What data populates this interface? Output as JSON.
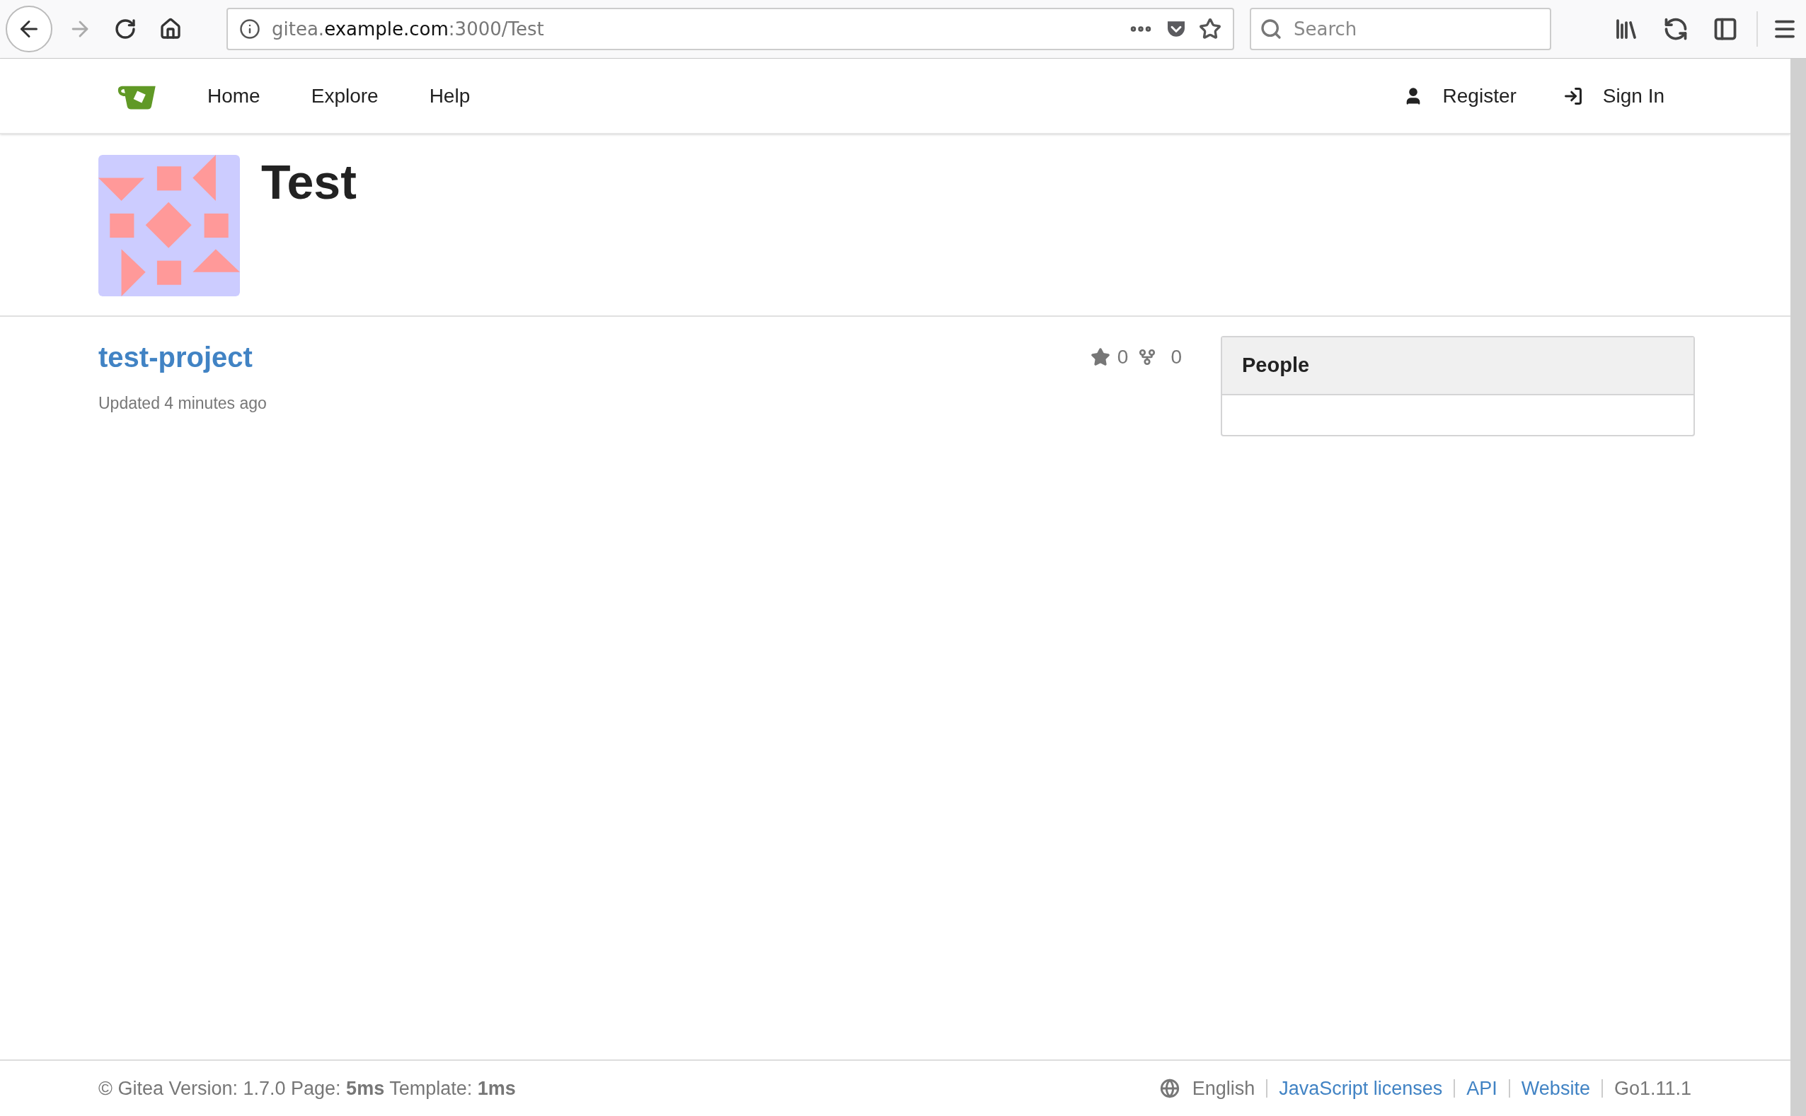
{
  "browser": {
    "url": {
      "prefix": "gitea.",
      "host": "example.com",
      "rest": ":3000/Test"
    },
    "search": {
      "placeholder": "Search"
    }
  },
  "nav": {
    "items": [
      "Home",
      "Explore",
      "Help"
    ],
    "right": [
      {
        "label": "Register",
        "kind": "register"
      },
      {
        "label": "Sign In",
        "kind": "signin"
      }
    ]
  },
  "org": {
    "name": "Test"
  },
  "repos": [
    {
      "name": "test-project",
      "updated": "Updated 4 minutes ago",
      "star_count": "0",
      "fork_count": "0"
    }
  ],
  "people": {
    "title": "People"
  },
  "footer": {
    "version": "© Gitea Version: 1.7.0 Page: **5ms** Template: **1ms**",
    "language": "English",
    "links": [
      "JavaScript licenses",
      "API",
      "Website"
    ],
    "go": "Go1.11.1"
  }
}
